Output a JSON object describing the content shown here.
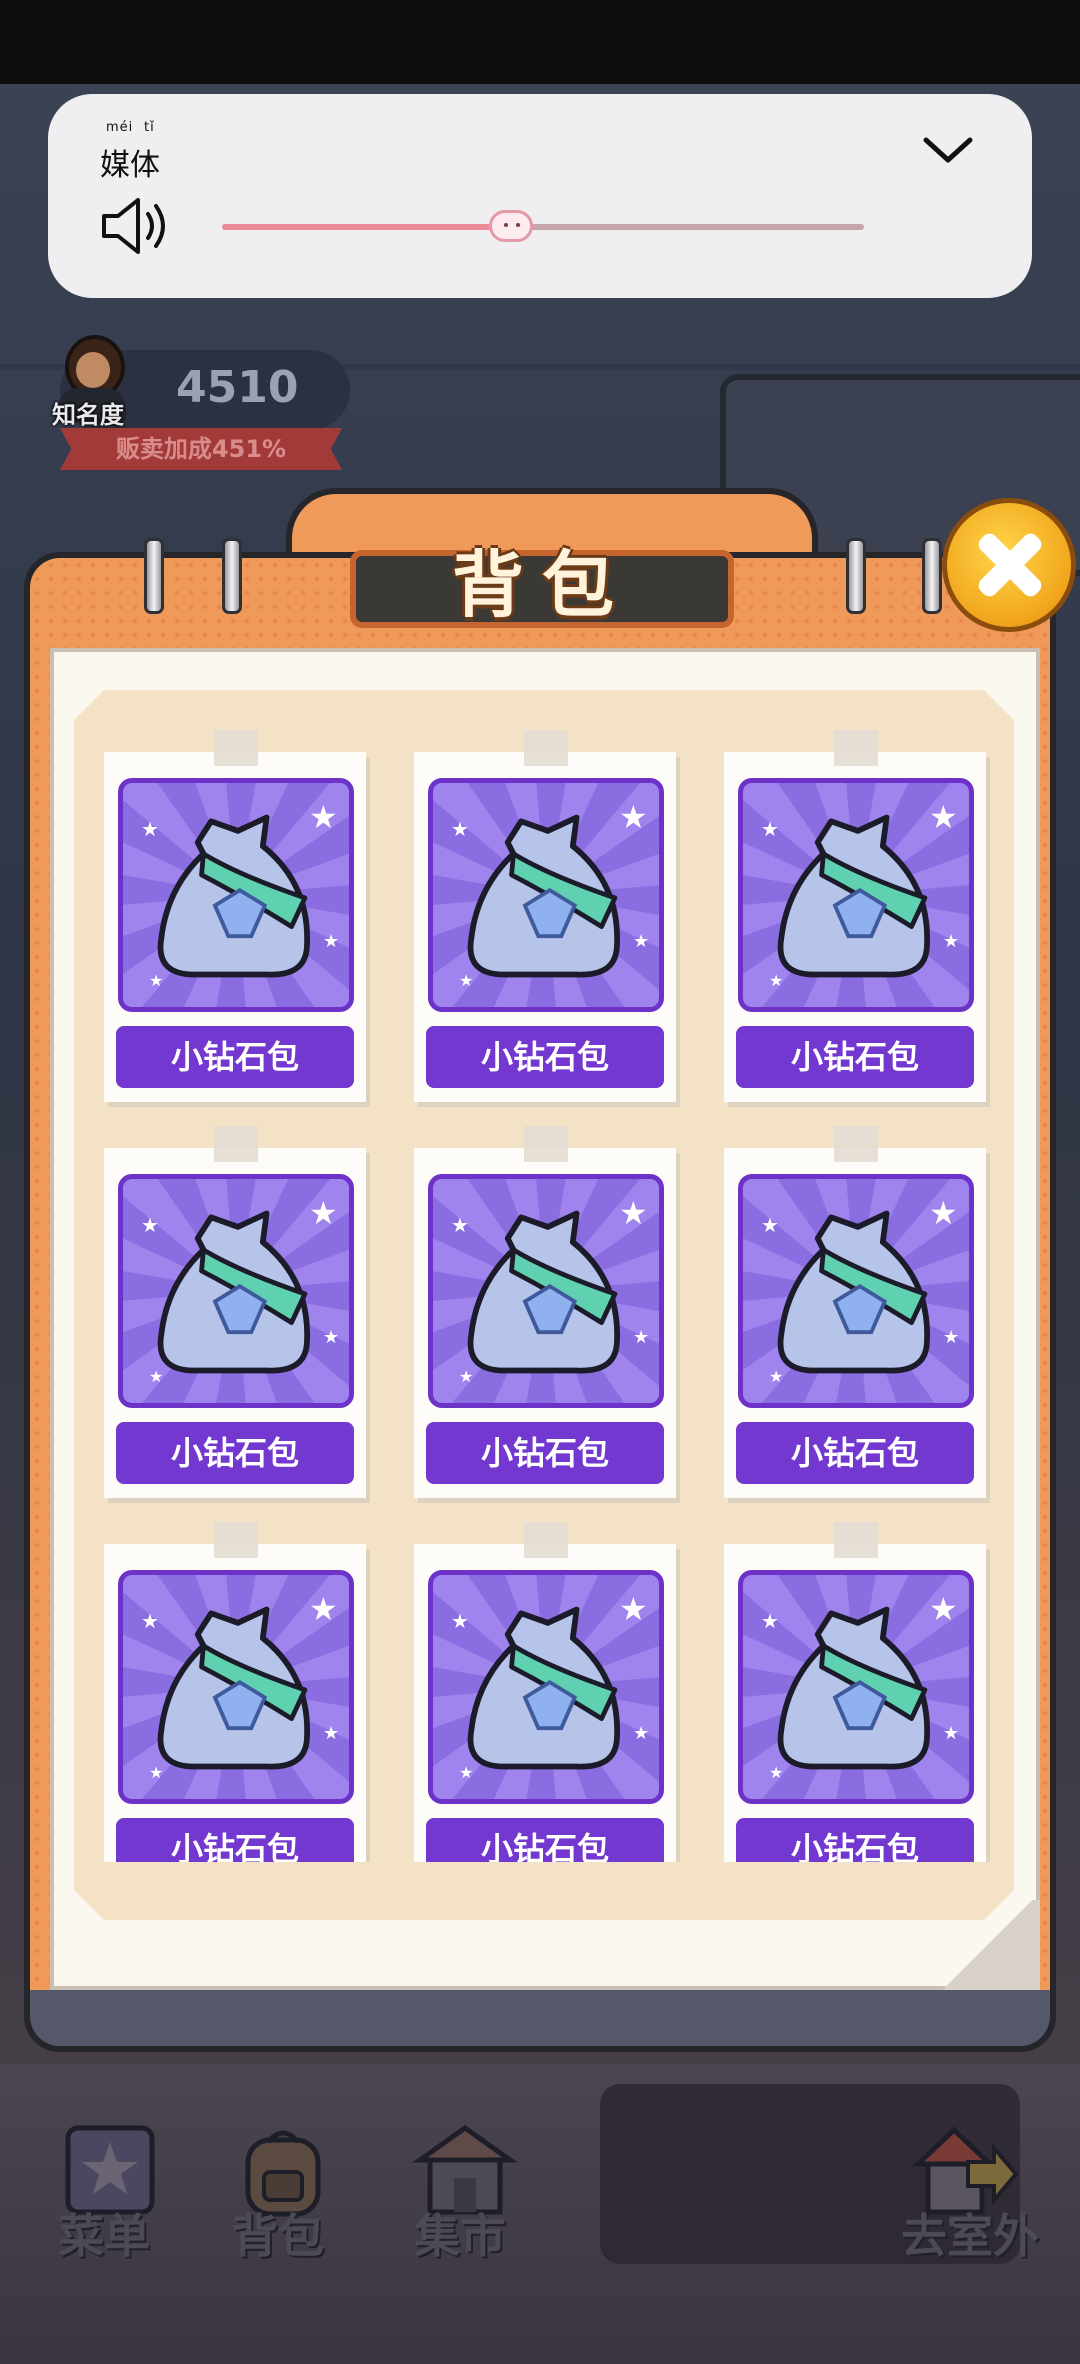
{
  "volume_panel": {
    "title": "媒体",
    "title_pinyin": [
      "méi",
      "tǐ"
    ],
    "level": 0.45,
    "colors": {
      "track": "#c5a6ad",
      "fill": "#ee8b98"
    }
  },
  "player": {
    "fame_label": "知名度",
    "fame_value": "4510",
    "sale_bonus": "贩卖加成451%"
  },
  "backpack": {
    "title": "背包",
    "close_icon": "close-icon",
    "items": [
      {
        "name": "小钻石包",
        "icon": "diamond-bag-icon"
      },
      {
        "name": "小钻石包",
        "icon": "diamond-bag-icon"
      },
      {
        "name": "小钻石包",
        "icon": "diamond-bag-icon"
      },
      {
        "name": "小钻石包",
        "icon": "diamond-bag-icon"
      },
      {
        "name": "小钻石包",
        "icon": "diamond-bag-icon"
      },
      {
        "name": "小钻石包",
        "icon": "diamond-bag-icon"
      },
      {
        "name": "小钻石包",
        "icon": "diamond-bag-icon"
      },
      {
        "name": "小钻石包",
        "icon": "diamond-bag-icon"
      },
      {
        "name": "小钻石包",
        "icon": "diamond-bag-icon"
      }
    ],
    "colors": {
      "frame": "#f09a5a",
      "item_bg": "#9f84ee",
      "item_label_bg": "#7338d0"
    }
  },
  "nav": {
    "menu": "菜单",
    "bag": "背包",
    "market": "集市",
    "outside": "去室外"
  }
}
